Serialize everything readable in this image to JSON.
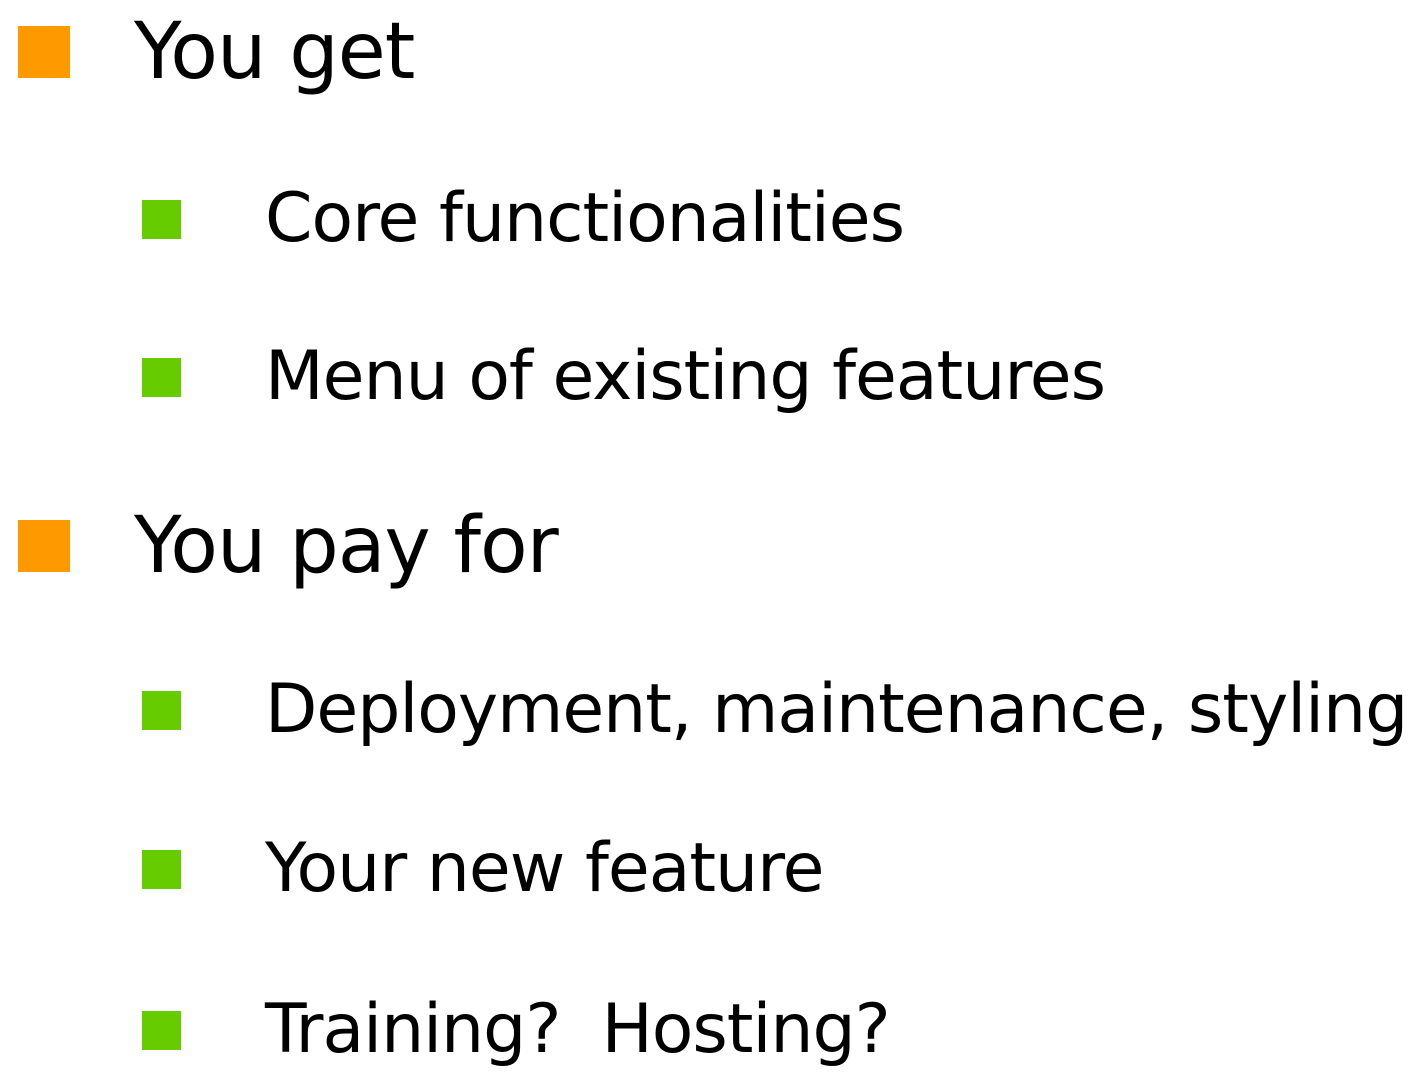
{
  "slide": {
    "colors": {
      "level1_bullet": "#FF9900",
      "level2_bullet": "#66CC00",
      "text": "#000000",
      "background": "#FFFFFF"
    },
    "bullets": [
      {
        "level": 1,
        "text": "You get"
      },
      {
        "level": 2,
        "text": "Core functionalities"
      },
      {
        "level": 2,
        "text": "Menu of existing features"
      },
      {
        "level": 1,
        "text": "You pay for"
      },
      {
        "level": 2,
        "text": "Deployment, maintenance, styling"
      },
      {
        "level": 2,
        "text": "Your new feature"
      },
      {
        "level": 2,
        "text": "Training?  Hosting?"
      }
    ]
  }
}
